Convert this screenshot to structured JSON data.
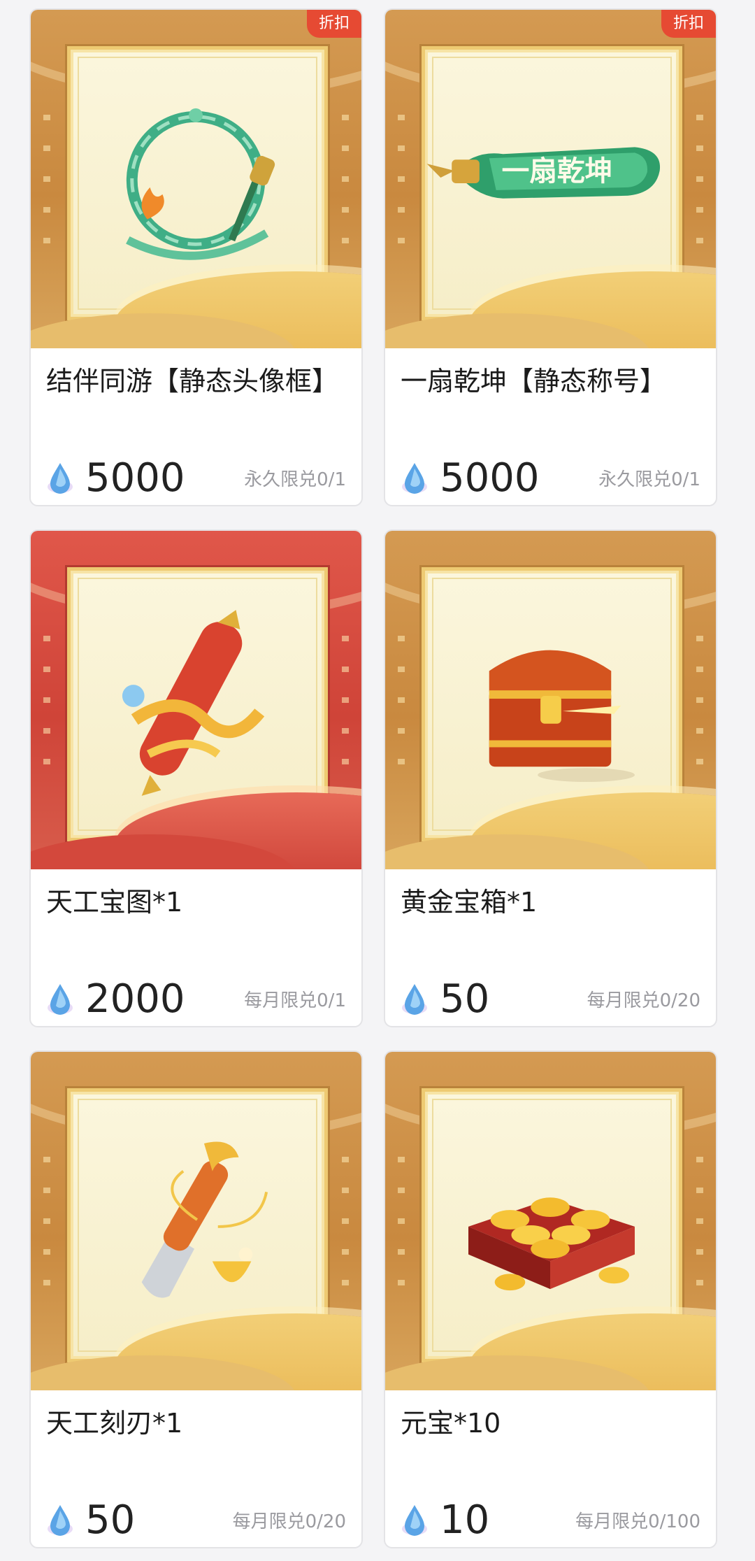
{
  "colors": {
    "tag_bg": "#e64a33",
    "price_text": "#222222",
    "limit_text": "#9a9a9f",
    "art_gold": "#d49a52",
    "art_red": "#e0574a"
  },
  "items": [
    {
      "title": "结伴同游【静态头像框】",
      "price": "5000",
      "limit": "永久限兑0/1",
      "tag": "折扣",
      "theme": "gold",
      "icon": "avatar-frame-ring-icon"
    },
    {
      "title": "一扇乾坤【静态称号】",
      "price": "5000",
      "limit": "永久限兑0/1",
      "tag": "折扣",
      "theme": "gold",
      "icon": "title-badge-icon",
      "badge_text": "一扇乾坤"
    },
    {
      "title": "天工宝图*1",
      "price": "2000",
      "limit": "每月限兑0/1",
      "tag": "",
      "theme": "red",
      "icon": "scroll-map-icon"
    },
    {
      "title": "黄金宝箱*1",
      "price": "50",
      "limit": "每月限兑0/20",
      "tag": "",
      "theme": "gold",
      "icon": "treasure-chest-icon"
    },
    {
      "title": "天工刻刃*1",
      "price": "50",
      "limit": "每月限兑0/20",
      "tag": "",
      "theme": "gold",
      "icon": "carving-blade-icon"
    },
    {
      "title": "元宝*10",
      "price": "10",
      "limit": "每月限兑0/100",
      "tag": "",
      "theme": "gold",
      "icon": "gold-ingots-icon"
    }
  ],
  "currency_icon": "crystal-drop-icon"
}
